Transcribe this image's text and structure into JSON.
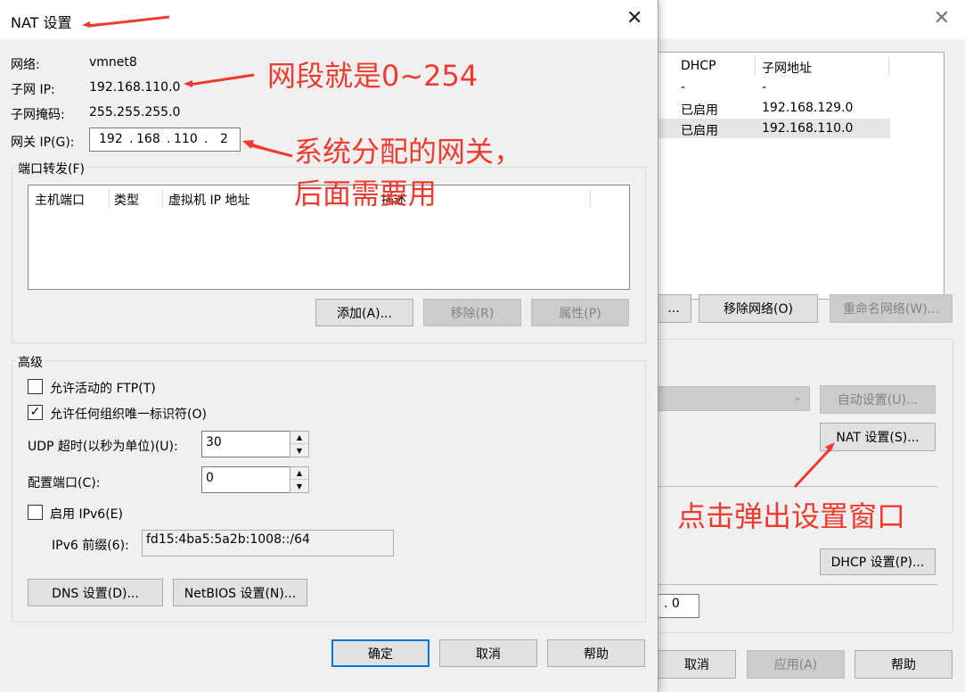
{
  "background_window": {
    "table": {
      "headers": [
        "DHCP",
        "子网地址"
      ],
      "rows": [
        {
          "dhcp": "-",
          "subnet": "-"
        },
        {
          "dhcp": "已启用",
          "subnet": "192.168.129.0"
        },
        {
          "dhcp": "已启用",
          "subnet": "192.168.110.0"
        }
      ]
    },
    "buttons": {
      "add_partial": "...",
      "remove_network": "移除网络(O)",
      "rename_network": "重命名网络(W)...",
      "auto_settings": "自动设置(U)...",
      "nat_settings": "NAT 设置(S)...",
      "dhcp_settings": "DHCP 设置(P)...",
      "cancel": "取消",
      "apply": "应用(A)",
      "help": "帮助"
    },
    "partial_ip_value": ". 0"
  },
  "dialog": {
    "title": "NAT 设置",
    "network_label": "网络:",
    "network_value": "vmnet8",
    "subnet_ip_label": "子网 IP:",
    "subnet_ip_value": "192.168.110.0",
    "subnet_mask_label": "子网掩码:",
    "subnet_mask_value": "255.255.255.0",
    "gateway_label": "网关 IP(G):",
    "gateway_octets": [
      "192",
      "168",
      "110",
      "2"
    ],
    "port_forwarding": {
      "title": "端口转发(F)",
      "columns": [
        "主机端口",
        "类型",
        "虚拟机 IP 地址",
        "描述"
      ],
      "buttons": {
        "add": "添加(A)...",
        "remove": "移除(R)",
        "properties": "属性(P)"
      }
    },
    "advanced": {
      "title": "高级",
      "allow_ftp": {
        "label": "允许活动的 FTP(T)",
        "checked": false
      },
      "allow_oui": {
        "label": "允许任何组织唯一标识符(O)",
        "checked": true
      },
      "udp_timeout_label": "UDP 超时(以秒为单位)(U):",
      "udp_timeout_value": "30",
      "config_port_label": "配置端口(C):",
      "config_port_value": "0",
      "enable_ipv6": {
        "label": "启用 IPv6(E)",
        "checked": false
      },
      "ipv6_prefix_label": "IPv6 前缀(6):",
      "ipv6_prefix_value": "fd15:4ba5:5a2b:1008::/64",
      "dns_button": "DNS 设置(D)...",
      "netbios_button": "NetBIOS 设置(N)..."
    },
    "footer": {
      "ok": "确定",
      "cancel": "取消",
      "help": "帮助"
    }
  },
  "annotations": {
    "subnet_note": "网段就是0~254",
    "gateway_note_line1": "系统分配的网关，",
    "gateway_note_line2": "后面需要用",
    "click_note": "点击弹出设置窗口"
  },
  "colors": {
    "annotation": "#ef3b2f",
    "focus": "#0078d7"
  }
}
